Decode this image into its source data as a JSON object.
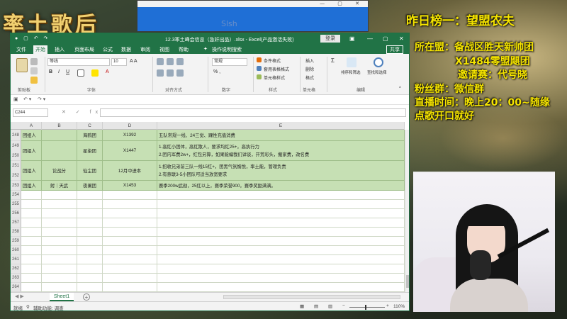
{
  "stream": {
    "logo": "率土歌后",
    "top_ranking": "昨日榜一：望盟农夫",
    "alliance_line": "所在盟：备战区胜天新帅团",
    "alliance_sub": "X1484零盟飓团",
    "invite_line": "邀请赛：代号晓",
    "fan_group": "粉丝群：微信群",
    "schedule": "直播时间：晚上20：00~随缘",
    "song_request": "点歌开口就好",
    "mini_window_text": "Slsh"
  },
  "excel": {
    "title": "12.3率土峰会信息（急奸出品）.xlsx - Excel(产品激活失败)",
    "login_label": "登录",
    "tabs": [
      "文件",
      "开始",
      "插入",
      "页面布局",
      "公式",
      "数据",
      "审阅",
      "视图",
      "帮助",
      "操作说明搜索"
    ],
    "active_tab": "开始",
    "share_label": "共享",
    "ribbon": {
      "clipboard_label": "剪贴板",
      "font_name": "等线",
      "font_size": "10",
      "font_label": "字体",
      "align_label": "对齐方式",
      "number_format": "常规",
      "number_label": "数字",
      "cond_format": "条件格式",
      "table_format": "套用表格格式",
      "cell_style": "单元格样式",
      "style_label": "样式",
      "insert": "插入",
      "delete": "删除",
      "format": "格式",
      "cells_label": "单元格",
      "sort_filter": "排序和筛选",
      "find_select": "查找和选择",
      "edit_label": "编辑"
    },
    "name_box": "C244",
    "columns": [
      "A",
      "B",
      "C",
      "D",
      "E"
    ],
    "rows": [
      {
        "num": "248",
        "a": "团组人",
        "b": "",
        "c": "海鸥团",
        "d": "X1392",
        "e": [
          "五队常规一线、24三觉、踝性充值消费"
        ],
        "green": true
      },
      {
        "num": "249",
        "a": "团组人",
        "b": "",
        "c": "星染团",
        "d": "X1447",
        "e": [
          "1.高红小团体，高红散人，要求均红25+，高执行力",
          "2.团内军费2w+，红包另算，如果能编我们详谈，开荒彩头，搬家费，改名费"
        ],
        "green": true,
        "merged_label": "250"
      },
      {
        "num": "251",
        "a": "团组人",
        "b": "论战分",
        "c": "仙尘团",
        "d": "12月中进本",
        "e": [
          "1.招收兄弟前三队一线15红+，团黑气氛愉悦，率土能，管理负责",
          "2.有意联3-5小团队可适当放宽要求"
        ],
        "green": true,
        "merged_label": "252"
      },
      {
        "num": "253",
        "a": "团组人",
        "b": "射｜天武",
        "c": "夜阑团",
        "d": "X1453",
        "e": [
          "赛季200w武勋，25红以上，赛季荣誉900，赛季奖励满满。"
        ],
        "green": true
      },
      {
        "num": "254"
      },
      {
        "num": "255"
      },
      {
        "num": "256"
      },
      {
        "num": "257"
      },
      {
        "num": "258"
      },
      {
        "num": "259"
      },
      {
        "num": "260"
      },
      {
        "num": "261"
      },
      {
        "num": "262"
      },
      {
        "num": "263"
      },
      {
        "num": "264"
      }
    ],
    "sheet_name": "Sheet1",
    "status_left": "就绪",
    "status_access": "辅助功能: 调查",
    "zoom": "110%"
  }
}
